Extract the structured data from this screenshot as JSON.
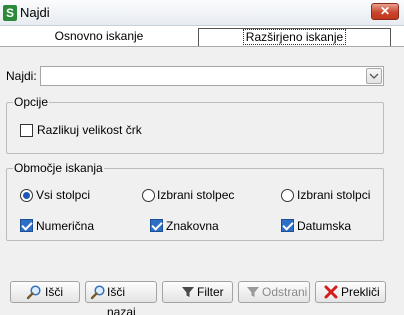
{
  "window": {
    "app_icon_letter": "S",
    "title": "Najdi",
    "close_symbol": "✕"
  },
  "tabs": [
    {
      "label": "Osnovno iskanje",
      "selected": false
    },
    {
      "label": "Razširjeno iskanje",
      "selected": true
    }
  ],
  "search": {
    "label": "Najdi:",
    "value": ""
  },
  "options": {
    "title": "Opcije",
    "case_sensitive": {
      "label": "Razlikuj velikost črk",
      "checked": false
    }
  },
  "scope": {
    "title": "Območje iskanja",
    "radios": [
      {
        "label": "Vsi stolpci",
        "selected": true
      },
      {
        "label": "Izbrani stolpec",
        "selected": false
      },
      {
        "label": "Izbrani stolpci",
        "selected": false
      }
    ],
    "types": [
      {
        "label": "Numerična",
        "checked": true
      },
      {
        "label": "Znakovna",
        "checked": true
      },
      {
        "label": "Datumska",
        "checked": true
      }
    ]
  },
  "buttons": {
    "find": "Išči",
    "find_back": "Išči nazaj",
    "filter": "Filter",
    "remove": "Odstrani",
    "cancel": "Prekliči"
  },
  "colors": {
    "accent": "#2b6fc7",
    "close": "#c9452b",
    "app_icon": "#2a8a3a"
  }
}
